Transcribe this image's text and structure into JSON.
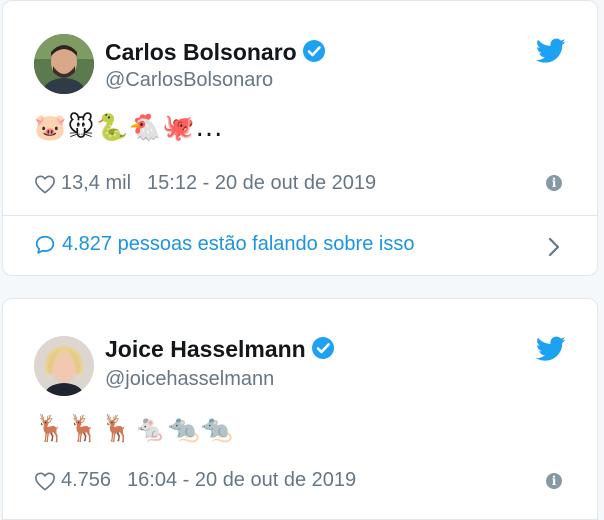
{
  "colors": {
    "accent": "#1da1f2",
    "link": "#1b95e0",
    "secondary_text": "#657786",
    "border": "#e1e8ed"
  },
  "tweets": [
    {
      "display_name": "Carlos Bolsonaro",
      "handle": "@CarlosBolsonaro",
      "verified": true,
      "body": "🐷🐭🐍🐔🐙...",
      "likes": "13,4 mil",
      "timestamp": "15:12 - 20 de out de 2019",
      "conversation": "4.827 pessoas estão falando sobre isso"
    },
    {
      "display_name": "Joice Hasselmann",
      "handle": "@joicehasselmann",
      "verified": true,
      "body": "🦌🦌🦌🐁🐀🐀",
      "likes": "4.756",
      "timestamp": "16:04 - 20 de out de 2019"
    }
  ],
  "icons": [
    "verified-badge-icon",
    "twitter-bird-icon",
    "heart-icon",
    "info-icon",
    "speech-bubble-icon",
    "chevron-right-icon"
  ]
}
